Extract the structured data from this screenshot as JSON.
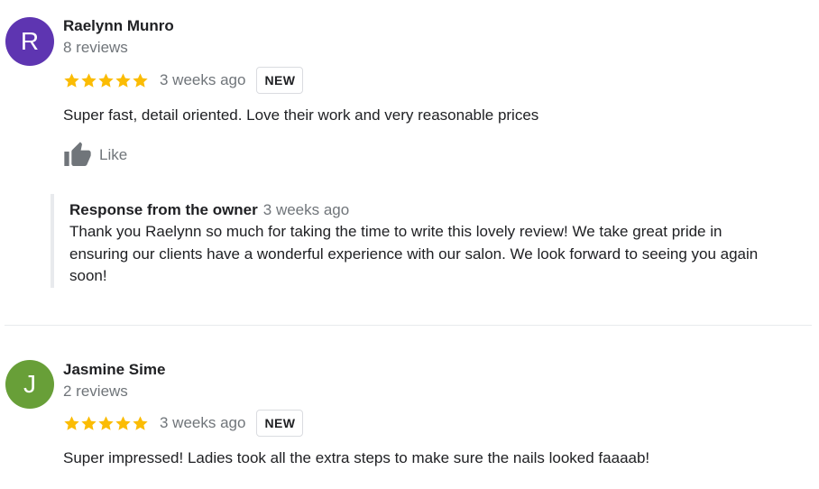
{
  "reviews": [
    {
      "avatar_letter": "R",
      "avatar_color": "#5e35b1",
      "name": "Raelynn Munro",
      "review_count": "8 reviews",
      "rating": 5,
      "age": "3 weeks ago",
      "badge": "NEW",
      "text": "Super fast, detail oriented. Love their work and very reasonable prices",
      "like_label": "Like",
      "owner_response": {
        "title": "Response from the owner",
        "age": "3 weeks ago",
        "text": "Thank you Raelynn so much for taking the time to write this lovely review! We take great pride in ensuring our clients have a wonderful experience with our salon. We look forward to seeing you again soon!"
      }
    },
    {
      "avatar_letter": "J",
      "avatar_color": "#689f38",
      "name": "Jasmine Sime",
      "review_count": "2 reviews",
      "rating": 5,
      "age": "3 weeks ago",
      "badge": "NEW",
      "text": "Super impressed! Ladies took all the extra steps to make sure the nails looked faaaab!"
    }
  ],
  "colors": {
    "star": "#fbbc04",
    "secondary_text": "#70757a",
    "divider": "#e8eaed"
  },
  "icons": {
    "more": "more-vert-icon",
    "like": "thumb-up-icon",
    "star": "star-icon"
  }
}
